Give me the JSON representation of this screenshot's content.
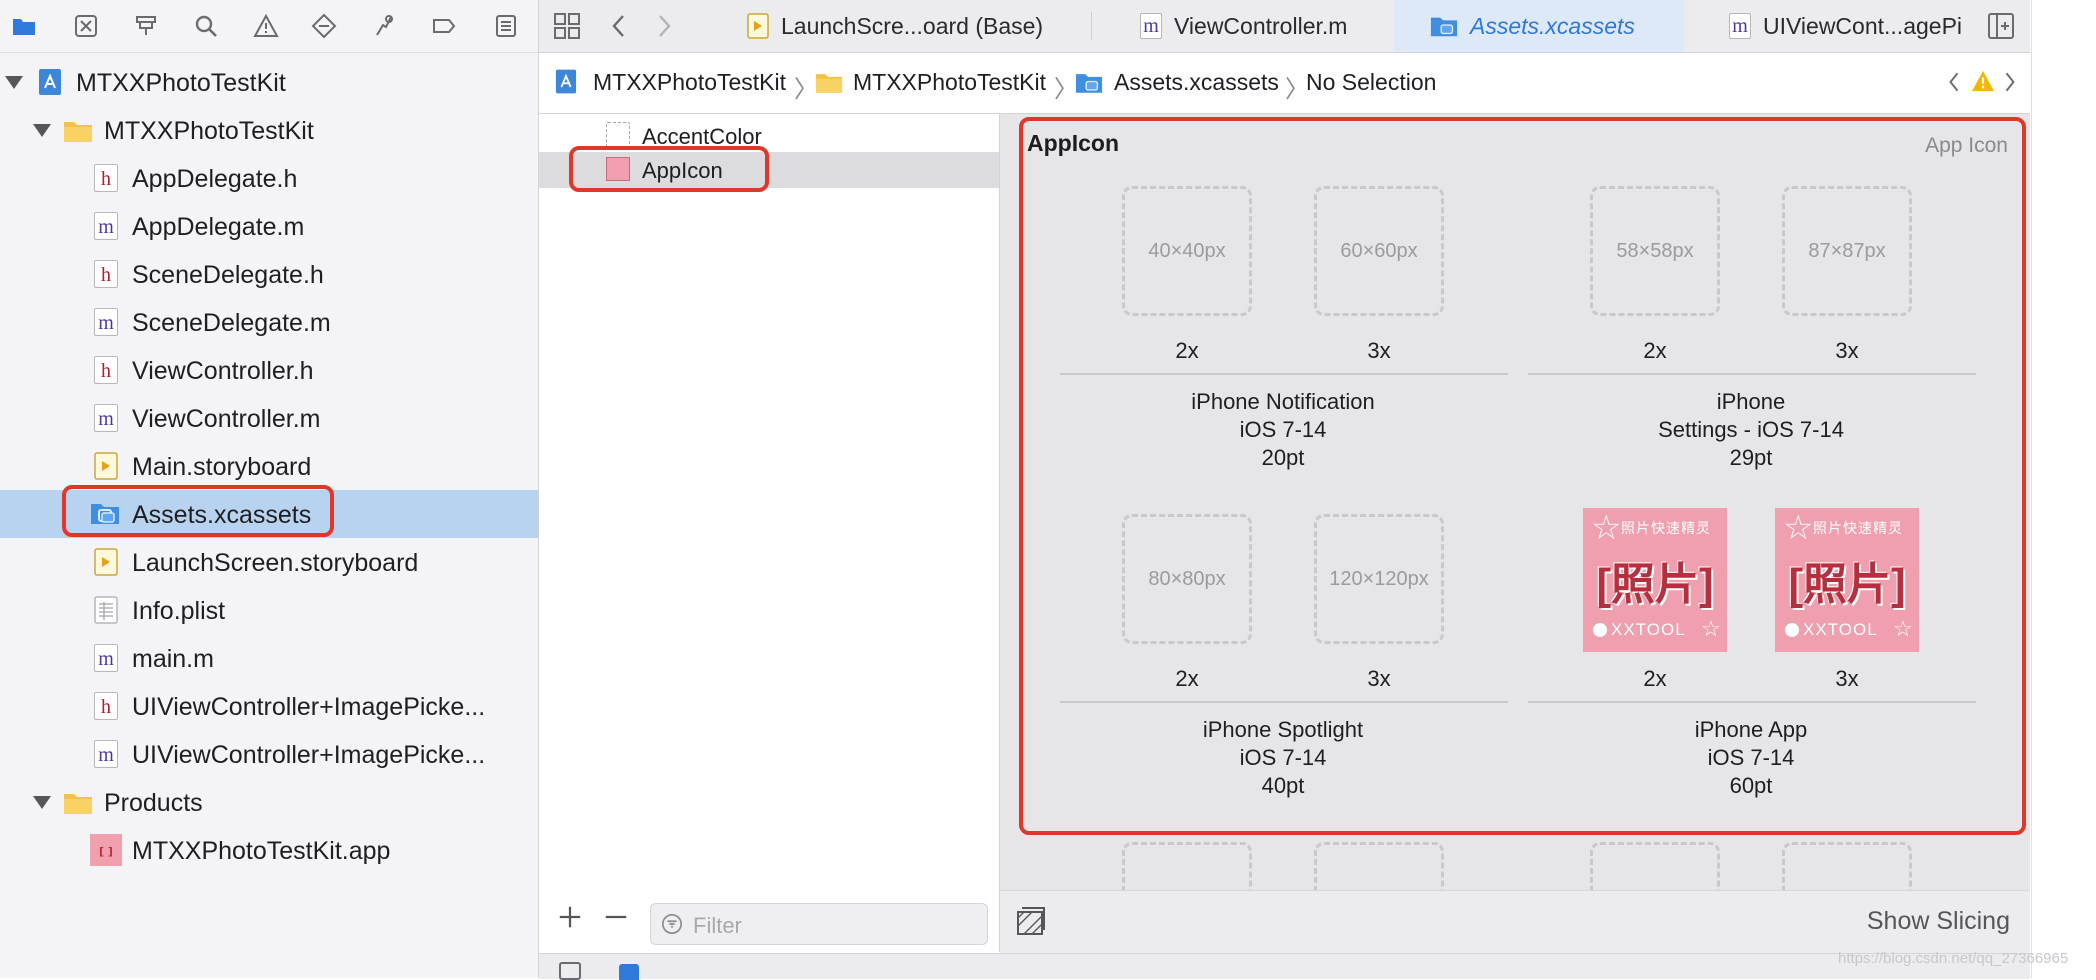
{
  "navigator": {
    "toolbar_icons": [
      "folder-icon",
      "source-control-icon",
      "symbol-icon",
      "search-icon",
      "warning-icon",
      "test-icon",
      "debug-icon",
      "breakpoint-icon",
      "report-icon"
    ],
    "items": [
      {
        "label": "MTXXPhotoTestKit",
        "kind": "project",
        "icon": "project-icon"
      },
      {
        "label": "MTXXPhotoTestKit",
        "kind": "group",
        "icon": "folder-icon"
      },
      {
        "label": "AppDelegate.h",
        "kind": "file",
        "icon": "header-file-icon",
        "badge": "h"
      },
      {
        "label": "AppDelegate.m",
        "kind": "file",
        "icon": "objc-file-icon",
        "badge": "m"
      },
      {
        "label": "SceneDelegate.h",
        "kind": "file",
        "icon": "header-file-icon",
        "badge": "h"
      },
      {
        "label": "SceneDelegate.m",
        "kind": "file",
        "icon": "objc-file-icon",
        "badge": "m"
      },
      {
        "label": "ViewController.h",
        "kind": "file",
        "icon": "header-file-icon",
        "badge": "h"
      },
      {
        "label": "ViewController.m",
        "kind": "file",
        "icon": "objc-file-icon",
        "badge": "m"
      },
      {
        "label": "Main.storyboard",
        "kind": "file",
        "icon": "storyboard-icon"
      },
      {
        "label": "Assets.xcassets",
        "kind": "file",
        "icon": "asset-catalog-icon",
        "selected": true
      },
      {
        "label": "LaunchScreen.storyboard",
        "kind": "file",
        "icon": "storyboard-icon"
      },
      {
        "label": "Info.plist",
        "kind": "file",
        "icon": "plist-icon"
      },
      {
        "label": "main.m",
        "kind": "file",
        "icon": "objc-file-icon",
        "badge": "m"
      },
      {
        "label": "UIViewController+ImagePicke...",
        "kind": "file",
        "icon": "header-file-icon",
        "badge": "h"
      },
      {
        "label": "UIViewController+ImagePicke...",
        "kind": "file",
        "icon": "objc-file-icon",
        "badge": "m"
      },
      {
        "label": "Products",
        "kind": "group",
        "icon": "folder-icon"
      },
      {
        "label": "MTXXPhotoTestKit.app",
        "kind": "file",
        "icon": "app-icon"
      }
    ]
  },
  "tabs": [
    {
      "label": "LaunchScre...oard (Base)",
      "icon": "storyboard-icon"
    },
    {
      "label": "ViewController.m",
      "icon": "objc-file-icon",
      "badge": "m"
    },
    {
      "label": "Assets.xcassets",
      "icon": "asset-catalog-icon",
      "active": true
    },
    {
      "label": "UIViewCont...agePi",
      "icon": "objc-file-icon",
      "badge": "m"
    }
  ],
  "breadcrumb": [
    "MTXXPhotoTestKit",
    "MTXXPhotoTestKit",
    "Assets.xcassets",
    "No Selection"
  ],
  "asset_list": {
    "items": [
      {
        "label": "AccentColor",
        "icon": "color-set-icon"
      },
      {
        "label": "AppIcon",
        "icon": "app-icon-set-icon",
        "selected": true
      }
    ],
    "filter_placeholder": "Filter"
  },
  "editor": {
    "title": "AppIcon",
    "type_label": "App Icon",
    "groups": [
      {
        "title": [
          "iPhone Notification",
          "iOS 7-14",
          "20pt"
        ],
        "slots": [
          {
            "size": "40×40px",
            "scale": "2x",
            "filled": false
          },
          {
            "size": "60×60px",
            "scale": "3x",
            "filled": false
          }
        ]
      },
      {
        "title": [
          "iPhone",
          "Settings - iOS 7-14",
          "29pt"
        ],
        "slots": [
          {
            "size": "58×58px",
            "scale": "2x",
            "filled": false
          },
          {
            "size": "87×87px",
            "scale": "3x",
            "filled": false
          }
        ]
      },
      {
        "title": [
          "iPhone Spotlight",
          "iOS 7-14",
          "40pt"
        ],
        "slots": [
          {
            "size": "80×80px",
            "scale": "2x",
            "filled": false
          },
          {
            "size": "120×120px",
            "scale": "3x",
            "filled": false
          }
        ]
      },
      {
        "title": [
          "iPhone App",
          "iOS 7-14",
          "60pt"
        ],
        "slots": [
          {
            "size": "",
            "scale": "2x",
            "filled": true
          },
          {
            "size": "",
            "scale": "3x",
            "filled": true
          }
        ]
      }
    ],
    "app_image": {
      "top_text": "照片快速精灵",
      "big_text": "[照片]",
      "brand": "XXTOOL"
    },
    "show_slicing": "Show Slicing"
  },
  "watermark": "https://blog.csdn.net/qq_27366965",
  "colors": {
    "highlight": "#e0372b",
    "selection": "#b7d3ef",
    "active_tab": "#2f77d8",
    "warning": "#f2b705"
  }
}
